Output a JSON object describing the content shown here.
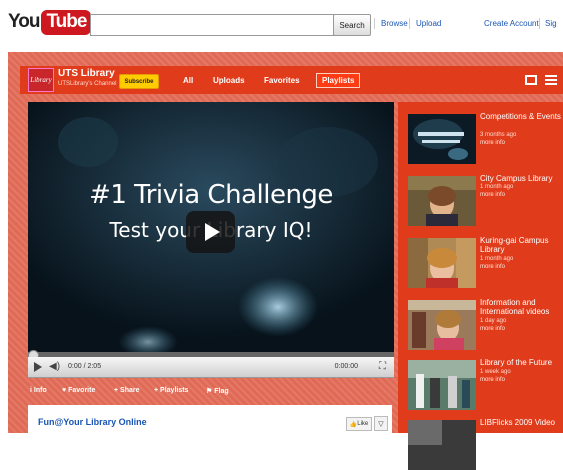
{
  "header": {
    "logo_you": "You",
    "logo_tube": "Tube",
    "search_placeholder": "",
    "search_button": "Search",
    "links": {
      "browse": "Browse",
      "upload": "Upload",
      "create_account": "Create Account",
      "sign_in": "Sig"
    }
  },
  "channel": {
    "avatar_text": "Library",
    "title": "UTS Library",
    "subtitle": "UTSLibrary's Channel",
    "subscribe": "Subscribe",
    "tabs": {
      "all": "All",
      "uploads": "Uploads",
      "favorites": "Favorites",
      "playlists": "Playlists"
    },
    "active_tab": "Playlists",
    "accent_color": "#e03c1c"
  },
  "video": {
    "title_line1": "#1 Trivia Challenge",
    "title_line2": "Test your Library IQ!",
    "current_time": "0:00 / 2:05",
    "total": "0:00:00",
    "progress_fraction": 0.0,
    "actions": {
      "info": "Info",
      "favorite": "Favorite",
      "share": "Share",
      "playlists": "Playlists",
      "flag": "Flag"
    },
    "info_title": "Fun@Your Library Online",
    "like": "Like"
  },
  "playlist": [
    {
      "title": "Competitions & Events",
      "meta": "3 months ago",
      "more": "more info"
    },
    {
      "title": "City Campus Library",
      "meta": "1 month ago",
      "more": "more info"
    },
    {
      "title": "Kuring-gai Campus Library",
      "meta": "1 month ago",
      "more": "more info"
    },
    {
      "title": "Information and International videos",
      "meta": "1 day ago",
      "more": "more info"
    },
    {
      "title": "Library of the Future",
      "meta": "1 week ago",
      "more": "more info"
    },
    {
      "title": "LIBFlicks 2009 Video",
      "meta": "",
      "more": ""
    }
  ]
}
